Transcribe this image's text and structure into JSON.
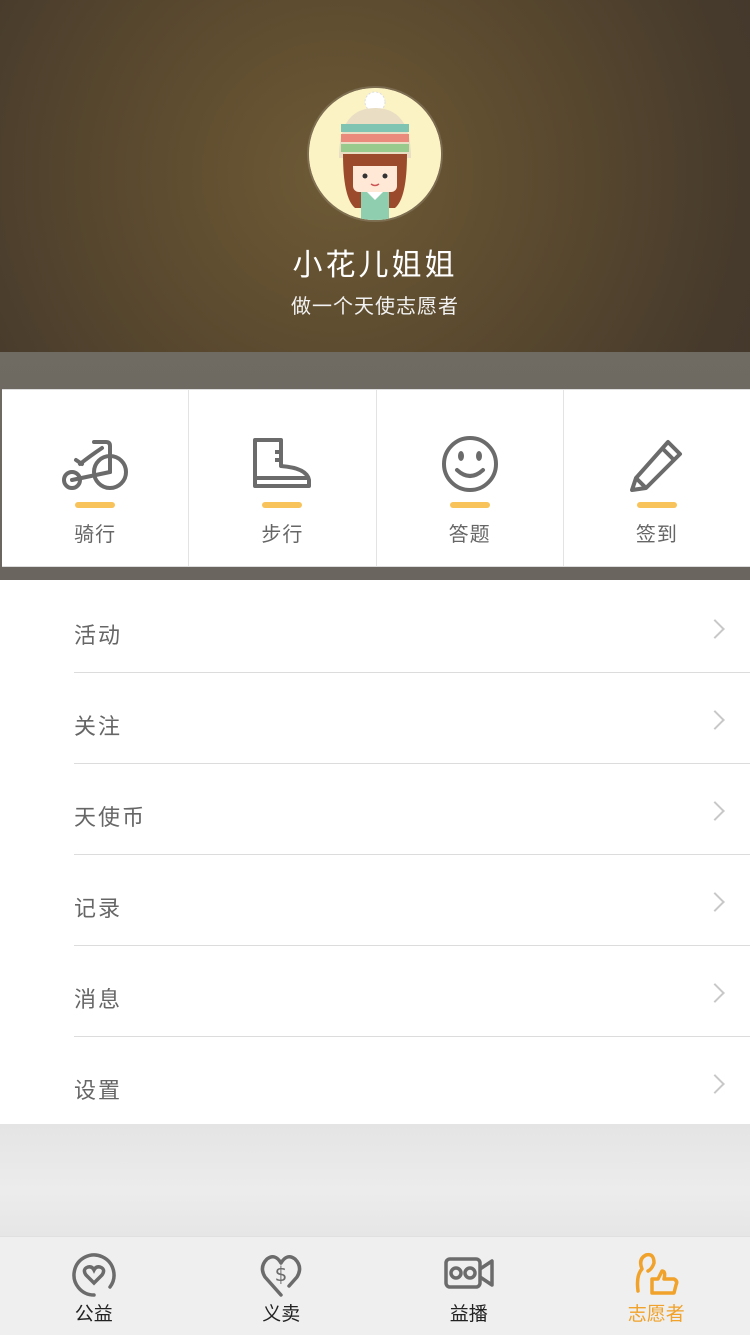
{
  "profile": {
    "name": "小花儿姐姐",
    "motto": "做一个天使志愿者"
  },
  "quick_actions": [
    {
      "label": "骑行",
      "icon": "bicycle-icon"
    },
    {
      "label": "步行",
      "icon": "boot-icon"
    },
    {
      "label": "答题",
      "icon": "smiley-icon"
    },
    {
      "label": "签到",
      "icon": "pencil-icon"
    }
  ],
  "menu": [
    {
      "label": "活动"
    },
    {
      "label": "关注"
    },
    {
      "label": "天使币"
    },
    {
      "label": "记录"
    },
    {
      "label": "消息"
    },
    {
      "label": "设置"
    }
  ],
  "tabs": [
    {
      "label": "公益",
      "icon": "heart-circle-icon"
    },
    {
      "label": "义卖",
      "icon": "dollar-heart-icon"
    },
    {
      "label": "益播",
      "icon": "video-camera-icon"
    },
    {
      "label": "志愿者",
      "icon": "volunteer-thumbs-up-icon",
      "active": true
    }
  ],
  "colors": {
    "accent": "#f0a22a",
    "quick_bar": "#f7c35a",
    "icon_gray": "#6b6b6b"
  }
}
